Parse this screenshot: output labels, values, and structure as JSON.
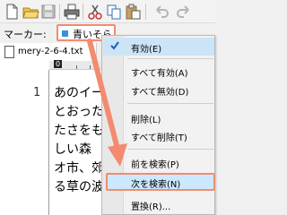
{
  "toolbar": {
    "icons": [
      "new-file-icon",
      "open-folder-icon",
      "save-icon",
      "print-icon",
      "cut-icon",
      "copy-icon",
      "paste-icon",
      "undo-icon",
      "redo-icon"
    ]
  },
  "marker_bar": {
    "label": "マーカー:",
    "selected": "青いそら",
    "swatch_color": "#3b8fe0"
  },
  "tab": {
    "title": "mery-2-6-4.txt"
  },
  "editor": {
    "ruler_start": "0",
    "line_number": "1",
    "lines": [
      "あのイー",
      "とおった",
      "たさをも",
      "しい森",
      "オ市、郊",
      "る草の波"
    ]
  },
  "context_menu": {
    "items": [
      {
        "label": "有効(E)",
        "checked": true
      },
      {
        "label": "すべて有効(A)"
      },
      {
        "label": "すべて無効(D)"
      },
      {
        "label": "削除(L)"
      },
      {
        "label": "すべて削除(T)"
      },
      {
        "label": "前を検索(P)"
      },
      {
        "label": "次を検索(N)",
        "highlighted": true
      },
      {
        "label": "置換(R)..."
      }
    ]
  },
  "colors": {
    "accent_highlight": "#f28b70",
    "menu_hover": "#cce8ff"
  }
}
